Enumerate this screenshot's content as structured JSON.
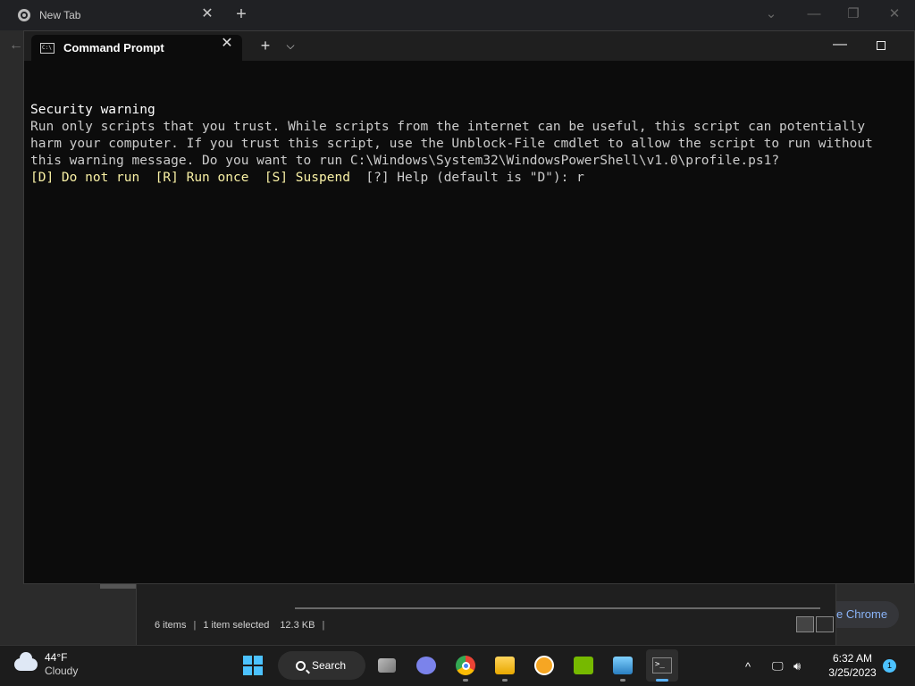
{
  "chrome": {
    "tab_title": "New Tab",
    "tab_close": "✕",
    "new_tab": "+",
    "sidebar_label": "e Chrome",
    "back_glyph": "←"
  },
  "terminal": {
    "tab_title": "Command Prompt",
    "tab_close": "✕",
    "add_tab": "+",
    "dropdown": "⌄",
    "minimize": "—",
    "lines": {
      "heading": "Security warning",
      "line1": "Run only scripts that you trust. While scripts from the internet can be useful, this script can potentially",
      "line2": "harm your computer. If you trust this script, use the Unblock-File cmdlet to allow the script to run without",
      "line3": "this warning message. Do you want to run C:\\Windows\\System32\\WindowsPowerShell\\v1.0\\profile.ps1?",
      "prompt_options": "[D] Do not run  [R] Run once  [S] Suspend  ",
      "prompt_help": "[?] Help (default is \"D\"): r"
    }
  },
  "explorer": {
    "items_count": "6 items",
    "selected": "1 item selected",
    "size": "12.3 KB",
    "separator": "|"
  },
  "taskbar": {
    "weather_temp": "44°F",
    "weather_condition": "Cloudy",
    "search_label": "Search",
    "time": "6:32 AM",
    "date": "3/25/2023",
    "notification_count": "1",
    "tray_chevron": "^",
    "accent": "#4cc2ff"
  }
}
